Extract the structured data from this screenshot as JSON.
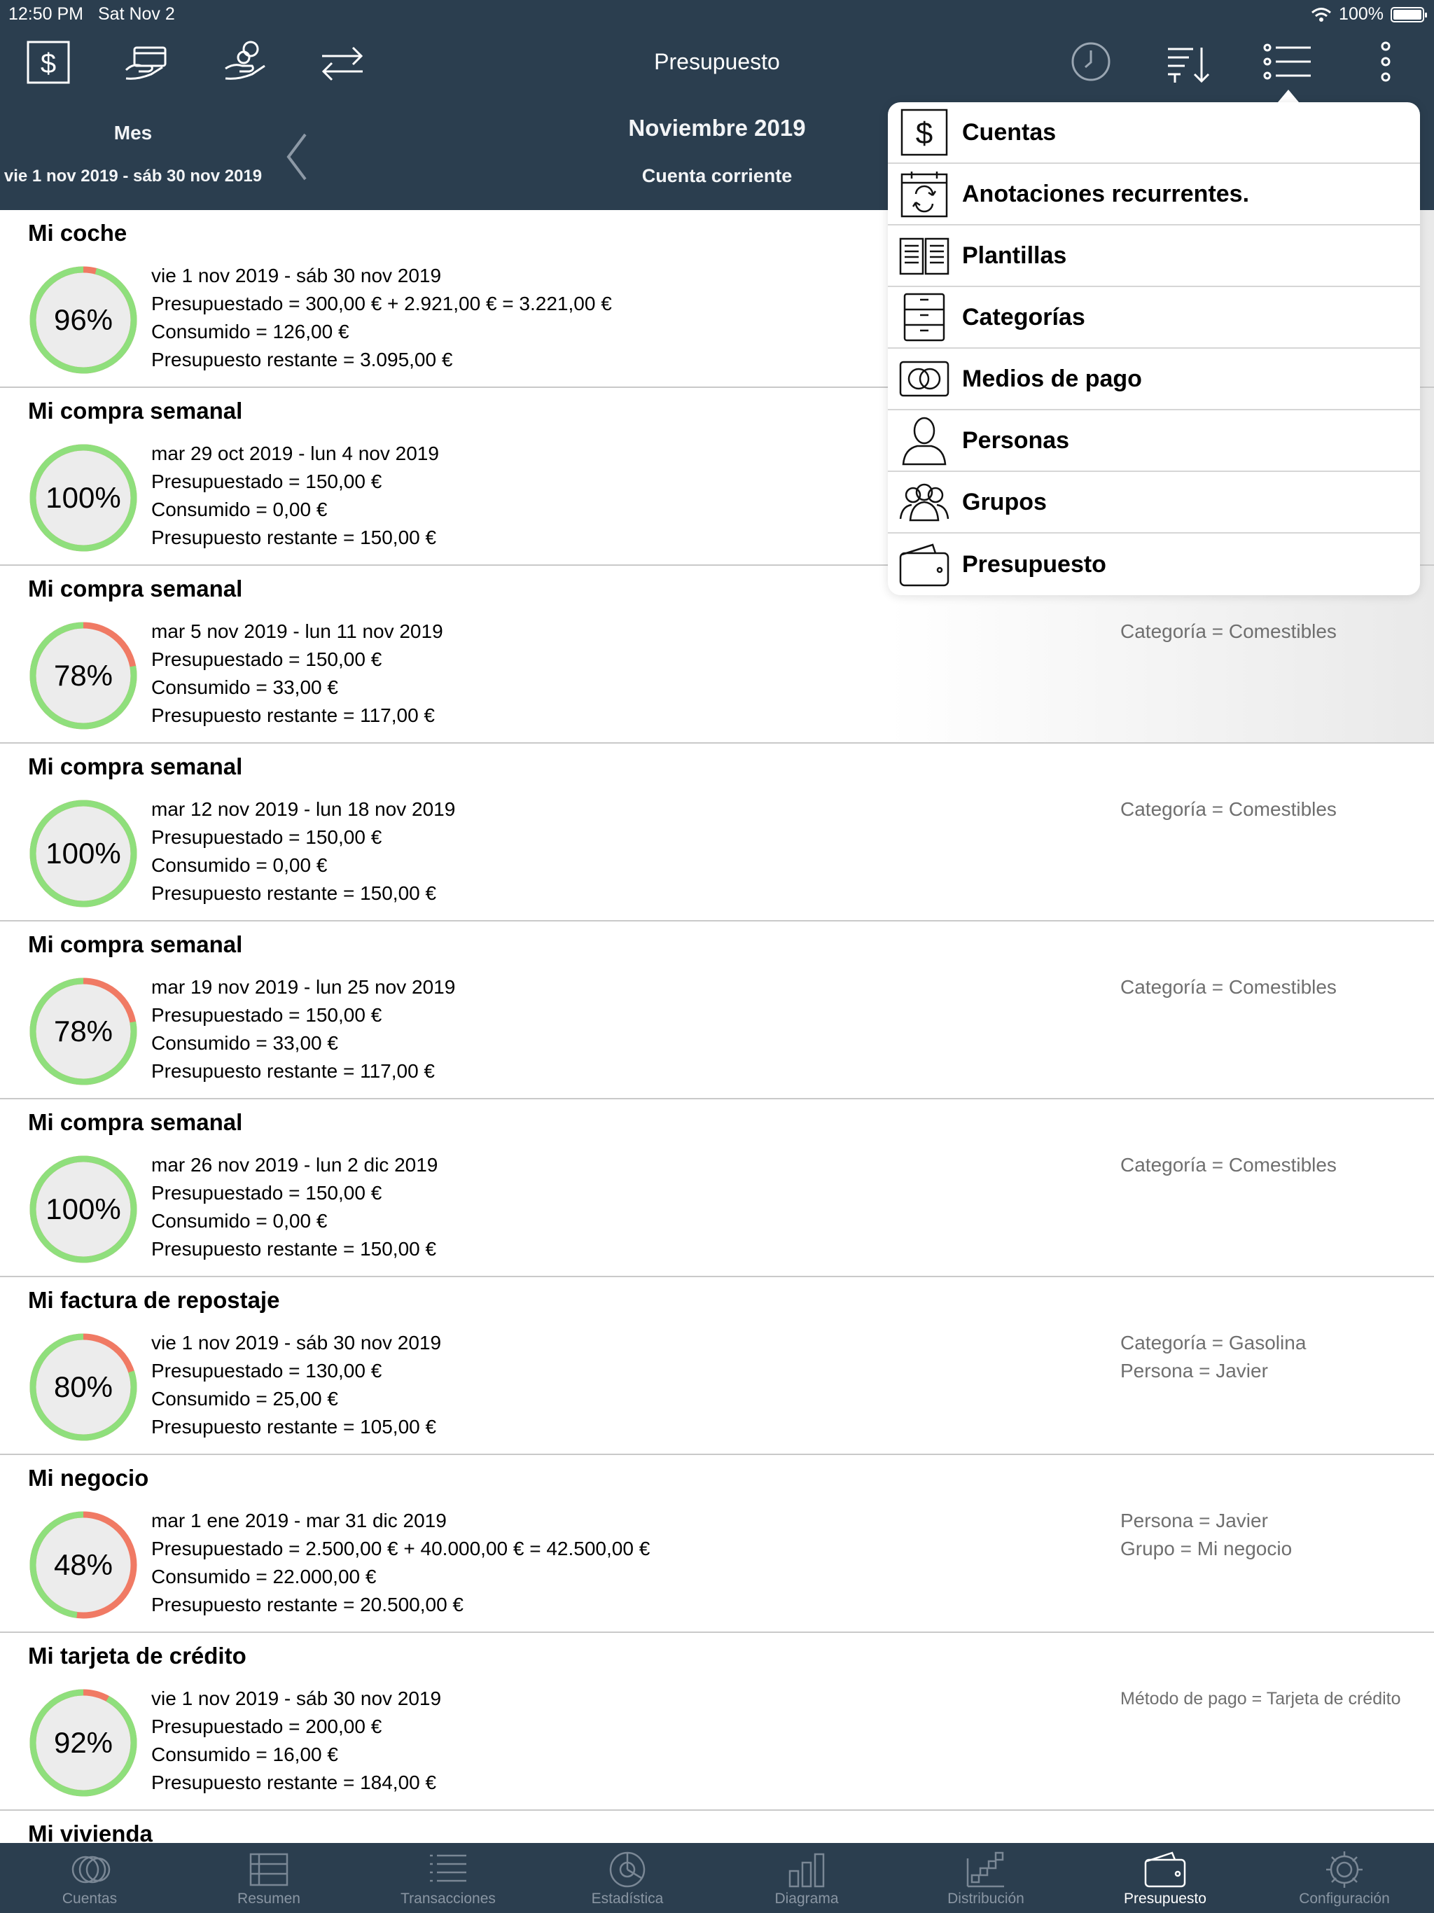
{
  "status_bar": {
    "time": "12:50 PM",
    "date": "Sat Nov 2",
    "battery": "100%"
  },
  "header": {
    "title": "Presupuesto",
    "period_type": "Mes",
    "period_range": "vie 1 nov 2019 - sáb 30 nov 2019",
    "month": "Noviembre 2019",
    "account": "Cuenta corriente",
    "toolbar_left": [
      "dollar-square-icon",
      "card-payment-icon",
      "coin-hand-icon",
      "transfer-arrows-icon"
    ],
    "toolbar_right": [
      "clock-icon",
      "sort-icon",
      "list-menu-icon",
      "more-vertical-icon"
    ]
  },
  "menu": {
    "items": [
      {
        "label": "Cuentas",
        "icon": "dollar-square-icon"
      },
      {
        "label": "Anotaciones recurrentes.",
        "icon": "recurring-calendar-icon"
      },
      {
        "label": "Plantillas",
        "icon": "template-book-icon"
      },
      {
        "label": "Categorías",
        "icon": "drawer-cabinet-icon"
      },
      {
        "label": "Medios de pago",
        "icon": "payment-coins-icon"
      },
      {
        "label": "Personas",
        "icon": "person-icon"
      },
      {
        "label": "Grupos",
        "icon": "group-icon"
      },
      {
        "label": "Presupuesto",
        "icon": "wallet-icon"
      }
    ]
  },
  "budgets": [
    {
      "title": "Mi coche",
      "percent": 96,
      "pct_label": "96%",
      "lines": [
        "vie 1 nov 2019 - sáb 30 nov 2019",
        "Presupuestado = 300,00 € + 2.921,00 € = 3.221,00 €",
        "Consumido = 126,00 €",
        "Presupuesto restante = 3.095,00 €"
      ],
      "filters": []
    },
    {
      "title": "Mi compra semanal",
      "percent": 100,
      "pct_label": "100%",
      "lines": [
        "mar 29 oct 2019 - lun 4 nov 2019",
        "Presupuestado = 150,00 €",
        "Consumido = 0,00 €",
        "Presupuesto restante = 150,00 €"
      ],
      "filters": []
    },
    {
      "title": "Mi compra semanal",
      "percent": 78,
      "pct_label": "78%",
      "lines": [
        "mar 5 nov 2019 - lun 11 nov 2019",
        "Presupuestado = 150,00 €",
        "Consumido = 33,00 €",
        "Presupuesto restante = 117,00 €"
      ],
      "filters": [
        "Categoría = Comestibles"
      ]
    },
    {
      "title": "Mi compra semanal",
      "percent": 100,
      "pct_label": "100%",
      "lines": [
        "mar 12 nov 2019 - lun 18 nov 2019",
        "Presupuestado = 150,00 €",
        "Consumido = 0,00 €",
        "Presupuesto restante = 150,00 €"
      ],
      "filters": [
        "Categoría = Comestibles"
      ]
    },
    {
      "title": "Mi compra semanal",
      "percent": 78,
      "pct_label": "78%",
      "lines": [
        "mar 19 nov 2019 - lun 25 nov 2019",
        "Presupuestado = 150,00 €",
        "Consumido = 33,00 €",
        "Presupuesto restante = 117,00 €"
      ],
      "filters": [
        "Categoría = Comestibles"
      ]
    },
    {
      "title": "Mi compra semanal",
      "percent": 100,
      "pct_label": "100%",
      "lines": [
        "mar 26 nov 2019 - lun 2 dic 2019",
        "Presupuestado = 150,00 €",
        "Consumido = 0,00 €",
        "Presupuesto restante = 150,00 €"
      ],
      "filters": [
        "Categoría = Comestibles"
      ]
    },
    {
      "title": "Mi factura de repostaje",
      "percent": 80,
      "pct_label": "80%",
      "lines": [
        "vie 1 nov 2019 - sáb 30 nov 2019",
        "Presupuestado = 130,00 €",
        "Consumido = 25,00 €",
        "Presupuesto restante = 105,00 €"
      ],
      "filters": [
        "Categoría = Gasolina",
        "Persona = Javier"
      ]
    },
    {
      "title": "Mi negocio",
      "percent": 48,
      "pct_label": "48%",
      "lines": [
        "mar 1 ene 2019 - mar 31 dic 2019",
        "Presupuestado = 2.500,00 € + 40.000,00 € = 42.500,00 €",
        "Consumido = 22.000,00 €",
        "Presupuesto restante = 20.500,00 €"
      ],
      "filters": [
        "Persona = Javier",
        "Grupo = Mi negocio"
      ]
    },
    {
      "title": "Mi tarjeta de crédito",
      "percent": 92,
      "pct_label": "92%",
      "lines": [
        "vie 1 nov 2019 - sáb 30 nov 2019",
        "Presupuestado = 200,00 €",
        "Consumido = 16,00 €",
        "Presupuesto restante = 184,00 €"
      ],
      "filters": [
        "Método de pago = Tarjeta de crédito"
      ]
    }
  ],
  "partial_row_title": "Mi vivienda",
  "tabbar": {
    "tabs": [
      {
        "label": "Cuentas",
        "icon": "coins-icon"
      },
      {
        "label": "Resumen",
        "icon": "summary-icon"
      },
      {
        "label": "Transacciones",
        "icon": "transactions-list-icon"
      },
      {
        "label": "Estadística",
        "icon": "statistics-pie-icon"
      },
      {
        "label": "Diagrama",
        "icon": "bar-chart-icon"
      },
      {
        "label": "Distribución",
        "icon": "distribution-icon"
      },
      {
        "label": "Presupuesto",
        "icon": "wallet-icon"
      },
      {
        "label": "Configuración",
        "icon": "gear-icon"
      }
    ],
    "active_index": 6
  },
  "colors": {
    "header_bg": "#2b3e4f",
    "ring_green": "#8fdf7c",
    "ring_red": "#f07a64",
    "ring_fill": "#ececec"
  }
}
